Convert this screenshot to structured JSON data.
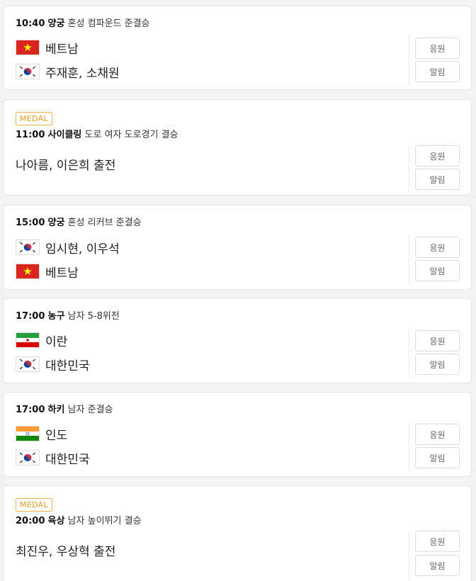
{
  "medal_label": "MEDAL",
  "buttons": {
    "cheer": "응원",
    "alert": "알림"
  },
  "matches": [
    {
      "time": "10:40",
      "sport": "양궁",
      "event": "혼성 컴파운드 준결승",
      "teams": [
        {
          "flag": "vietnam",
          "name": "베트남"
        },
        {
          "flag": "korea",
          "name": "주재훈, 소채원"
        }
      ]
    },
    {
      "medal": true,
      "time": "11:00",
      "sport": "사이클링",
      "event": "도로 여자 도로경기 결승",
      "summary": "나아름, 이은희 출전"
    },
    {
      "time": "15:00",
      "sport": "양궁",
      "event": "혼성 리커브 준결승",
      "teams": [
        {
          "flag": "korea",
          "name": "임시현, 이우석"
        },
        {
          "flag": "vietnam",
          "name": "베트남"
        }
      ]
    },
    {
      "time": "17:00",
      "sport": "농구",
      "event": "남자 5-8위전",
      "teams": [
        {
          "flag": "iran",
          "name": "이란"
        },
        {
          "flag": "korea",
          "name": "대한민국"
        }
      ]
    },
    {
      "time": "17:00",
      "sport": "하키",
      "event": "남자 준결승",
      "teams": [
        {
          "flag": "india",
          "name": "인도"
        },
        {
          "flag": "korea",
          "name": "대한민국"
        }
      ]
    },
    {
      "medal": true,
      "time": "20:00",
      "sport": "육상",
      "event": "남자 높이뛰기 결승",
      "summary": "최진우, 우상혁 출전"
    }
  ],
  "flag_colors": {
    "vietnam": {
      "bg": "#da251d",
      "star": "#ffff00"
    },
    "korea": {
      "bg": "#ffffff",
      "red": "#cd2e3a",
      "blue": "#0047a0",
      "bars": "#000000"
    },
    "iran": {
      "green": "#239f40",
      "white": "#ffffff",
      "red": "#da0000"
    },
    "india": {
      "saffron": "#ff9933",
      "white": "#ffffff",
      "green": "#138808",
      "chakra": "#000080"
    }
  }
}
